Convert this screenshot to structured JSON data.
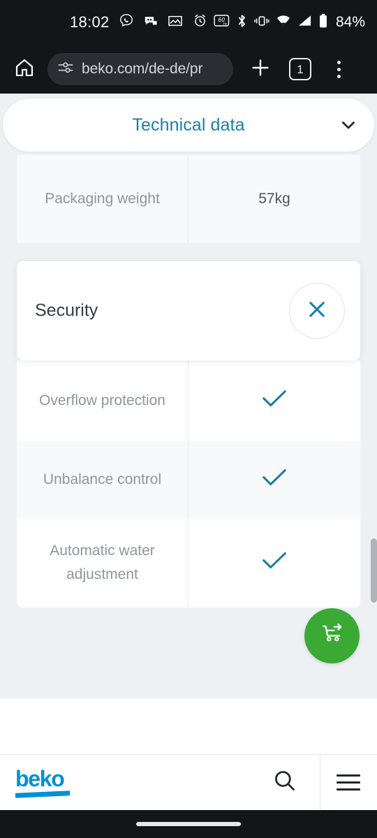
{
  "status_bar": {
    "time": "18:02",
    "battery_percent": "84%",
    "left_icons": [
      "viber-icon",
      "messaging-icon",
      "gallery-icon"
    ],
    "right_icons": [
      "alarm-icon",
      "refresh-rate-60hz-icon",
      "bluetooth-icon",
      "vibrate-icon",
      "wifi-icon",
      "cellular-signal-icon",
      "battery-icon"
    ]
  },
  "browser": {
    "url": "beko.com/de-de/pr",
    "tab_count": "1",
    "home_icon": "home-icon",
    "site_info_icon": "page-info-icon",
    "new_tab_icon": "plus-icon",
    "overflow_icon": "three-dot-menu-icon"
  },
  "page": {
    "section_selector": {
      "label": "Technical data",
      "chevron": "chevron-down-icon"
    },
    "spec_rows": [
      {
        "label": "Packaging weight",
        "value": "57kg",
        "value_type": "text"
      },
      {
        "label": "Overflow protection",
        "value": "",
        "value_type": "check"
      },
      {
        "label": "Unbalance control",
        "value": "",
        "value_type": "check"
      },
      {
        "label": "Automatic water adjustment",
        "value": "",
        "value_type": "check"
      }
    ],
    "security_card": {
      "title": "Security",
      "close_icon": "close-x-icon"
    },
    "add_to_cart_fab": {
      "icon": "cart-arrow-icon"
    }
  },
  "site_footer": {
    "logo_text": "beko",
    "search_icon": "search-icon",
    "menu_icon": "hamburger-menu-icon"
  },
  "colors": {
    "brand_blue": "#0090d4",
    "link_blue": "#1b7eb3",
    "check_teal": "#1f7a9e",
    "cart_green": "#3aaa35",
    "page_bg": "#eef1f4",
    "chrome_dark": "#141519"
  }
}
